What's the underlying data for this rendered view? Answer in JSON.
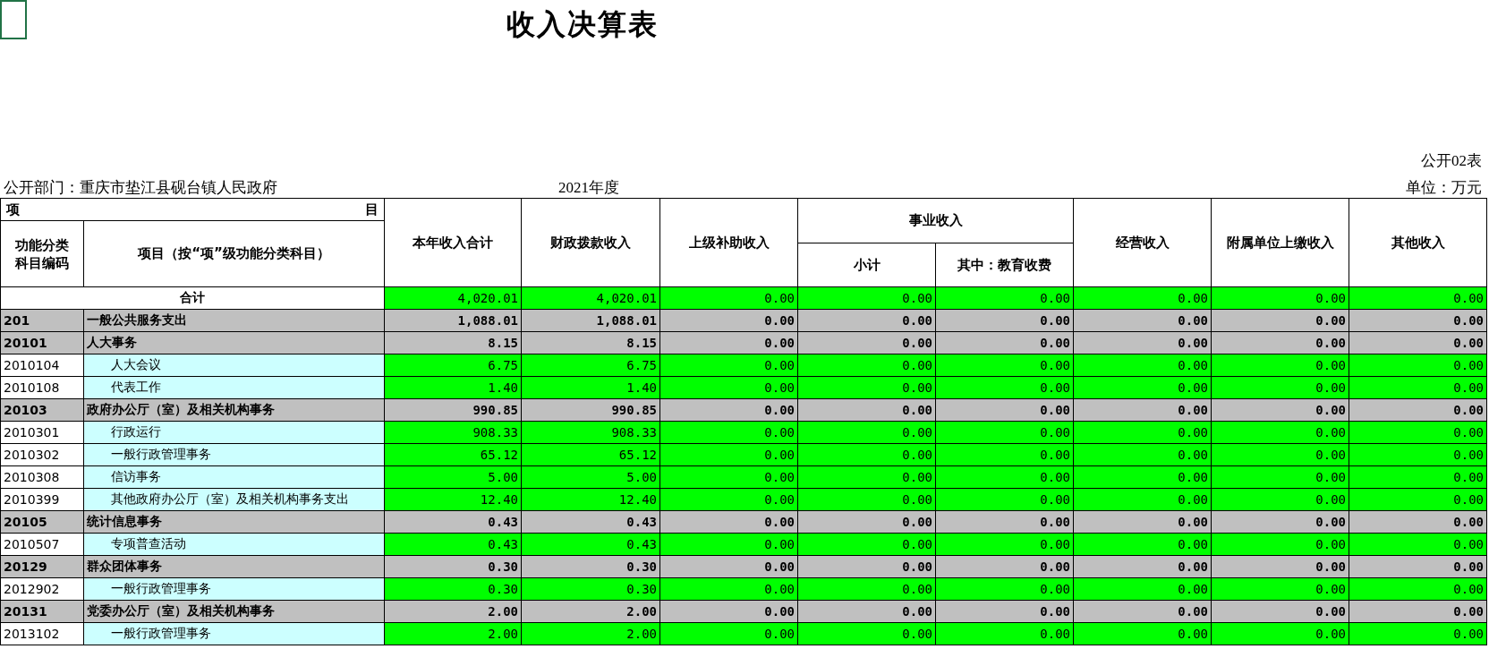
{
  "title": "收入决算表",
  "form_no": "公开02表",
  "department": "公开部门：重庆市垫江县砚台镇人民政府",
  "year": "2021年度",
  "unit": "单位：万元",
  "header": {
    "item_group": "项",
    "item_group_end": "目",
    "code_col": "功能分类科目编码",
    "name_col": "项目（按“项”级功能分类科目）",
    "total_col": "本年收入合计",
    "fiscal_col": "财政拨款收入",
    "subsidy_col": "上级补助收入",
    "business_group": "事业收入",
    "business_sub": "小计",
    "business_edu": "其中：教育收费",
    "operating_col": "经营收入",
    "affiliate_col": "附属单位上缴收入",
    "other_col": "其他收入"
  },
  "rows": [
    {
      "kind": "total",
      "name": "合计",
      "values": [
        "4,020.01",
        "4,020.01",
        "0.00",
        "0.00",
        "0.00",
        "0.00",
        "0.00",
        "0.00"
      ]
    },
    {
      "kind": "category",
      "code": "201",
      "name": "一般公共服务支出",
      "values": [
        "1,088.01",
        "1,088.01",
        "0.00",
        "0.00",
        "0.00",
        "0.00",
        "0.00",
        "0.00"
      ]
    },
    {
      "kind": "category",
      "code": "20101",
      "name": "人大事务",
      "values": [
        "8.15",
        "8.15",
        "0.00",
        "0.00",
        "0.00",
        "0.00",
        "0.00",
        "0.00"
      ]
    },
    {
      "kind": "item",
      "code": "2010104",
      "name": "人大会议",
      "values": [
        "6.75",
        "6.75",
        "0.00",
        "0.00",
        "0.00",
        "0.00",
        "0.00",
        "0.00"
      ]
    },
    {
      "kind": "item",
      "code": "2010108",
      "name": "代表工作",
      "values": [
        "1.40",
        "1.40",
        "0.00",
        "0.00",
        "0.00",
        "0.00",
        "0.00",
        "0.00"
      ]
    },
    {
      "kind": "category",
      "code": "20103",
      "name": "政府办公厅（室）及相关机构事务",
      "values": [
        "990.85",
        "990.85",
        "0.00",
        "0.00",
        "0.00",
        "0.00",
        "0.00",
        "0.00"
      ]
    },
    {
      "kind": "item",
      "code": "2010301",
      "name": "行政运行",
      "values": [
        "908.33",
        "908.33",
        "0.00",
        "0.00",
        "0.00",
        "0.00",
        "0.00",
        "0.00"
      ]
    },
    {
      "kind": "item",
      "code": "2010302",
      "name": "一般行政管理事务",
      "values": [
        "65.12",
        "65.12",
        "0.00",
        "0.00",
        "0.00",
        "0.00",
        "0.00",
        "0.00"
      ]
    },
    {
      "kind": "item",
      "code": "2010308",
      "name": "信访事务",
      "values": [
        "5.00",
        "5.00",
        "0.00",
        "0.00",
        "0.00",
        "0.00",
        "0.00",
        "0.00"
      ]
    },
    {
      "kind": "item",
      "code": "2010399",
      "name": "其他政府办公厅（室）及相关机构事务支出",
      "values": [
        "12.40",
        "12.40",
        "0.00",
        "0.00",
        "0.00",
        "0.00",
        "0.00",
        "0.00"
      ]
    },
    {
      "kind": "category",
      "code": "20105",
      "name": "统计信息事务",
      "values": [
        "0.43",
        "0.43",
        "0.00",
        "0.00",
        "0.00",
        "0.00",
        "0.00",
        "0.00"
      ]
    },
    {
      "kind": "item",
      "code": "2010507",
      "name": "专项普查活动",
      "values": [
        "0.43",
        "0.43",
        "0.00",
        "0.00",
        "0.00",
        "0.00",
        "0.00",
        "0.00"
      ]
    },
    {
      "kind": "category",
      "code": "20129",
      "name": "群众团体事务",
      "values": [
        "0.30",
        "0.30",
        "0.00",
        "0.00",
        "0.00",
        "0.00",
        "0.00",
        "0.00"
      ]
    },
    {
      "kind": "item",
      "code": "2012902",
      "name": "一般行政管理事务",
      "values": [
        "0.30",
        "0.30",
        "0.00",
        "0.00",
        "0.00",
        "0.00",
        "0.00",
        "0.00"
      ]
    },
    {
      "kind": "category",
      "code": "20131",
      "name": "党委办公厅（室）及相关机构事务",
      "values": [
        "2.00",
        "2.00",
        "0.00",
        "0.00",
        "0.00",
        "0.00",
        "0.00",
        "0.00"
      ]
    },
    {
      "kind": "item",
      "code": "2013102",
      "name": "一般行政管理事务",
      "values": [
        "2.00",
        "2.00",
        "0.00",
        "0.00",
        "0.00",
        "0.00",
        "0.00",
        "0.00"
      ]
    }
  ]
}
